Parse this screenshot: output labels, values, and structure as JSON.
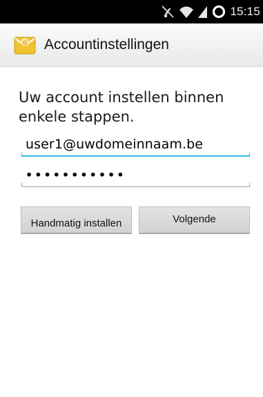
{
  "status_bar": {
    "time": "15:15",
    "icons": [
      "mute-icon",
      "wifi-icon",
      "signal-icon",
      "sync-icon"
    ]
  },
  "action_bar": {
    "title": "Accountinstellingen",
    "icon": "email-app-icon"
  },
  "form": {
    "headline": "Uw account instellen binnen enkele stappen.",
    "email_value": "user1@uwdomeinnaam.be",
    "password_value": "•••••••••••"
  },
  "buttons": {
    "manual_label": "Handmatig installen",
    "next_label": "Volgende"
  },
  "colors": {
    "accent": "#33b5e5",
    "status_bar": "#000000",
    "button": "#d8d8d8"
  }
}
